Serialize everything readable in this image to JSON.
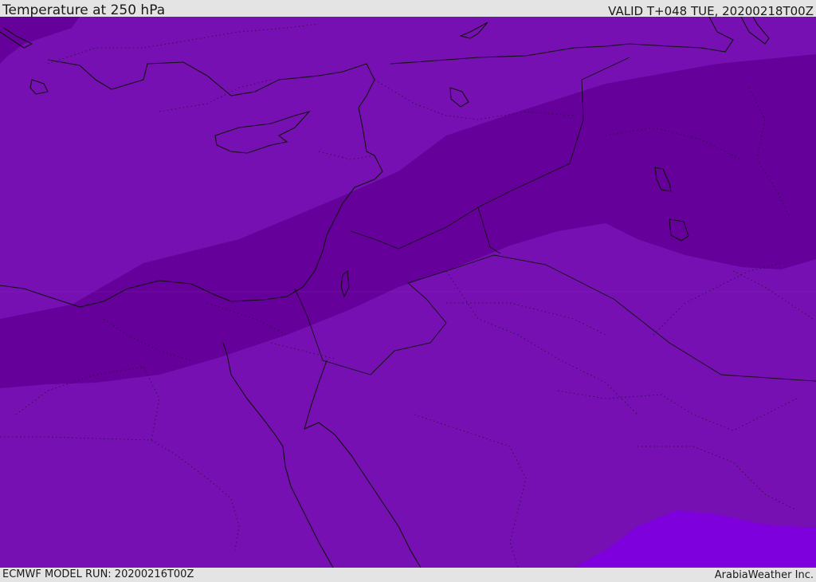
{
  "header": {
    "title": "Temperature at 250 hPa",
    "valid": "VALID T+048 TUE, 20200218T00Z"
  },
  "footer": {
    "model_run": "ECMWF MODEL RUN: 20200216T00Z",
    "credit": "ArabiaWeather Inc."
  },
  "colors": {
    "background": "#e4e4e4",
    "field_main": "#7710b2",
    "field_cold_band": "#66009a",
    "field_warm_patch": "#7e00dc",
    "coastline": "#111111",
    "border_dotted": "#2a0a3a"
  }
}
